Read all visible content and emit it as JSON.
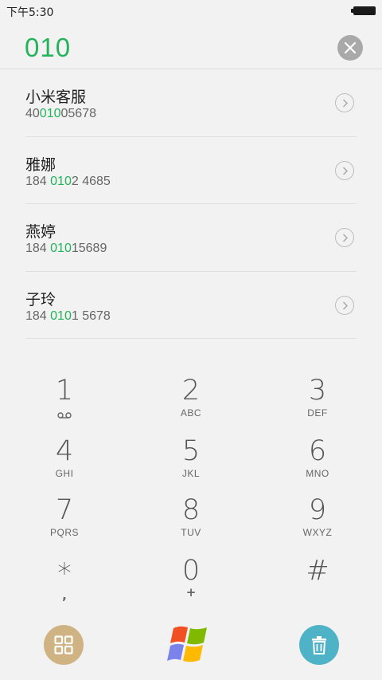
{
  "status": {
    "time": "下午5:30"
  },
  "dialer": {
    "number": "010",
    "contacts": [
      {
        "name": "小米客服",
        "num_pre": "40",
        "num_match": "010",
        "num_post": "05678"
      },
      {
        "name": "雅娜",
        "num_pre": "184 ",
        "num_match": "010",
        "num_post": "2 4685"
      },
      {
        "name": "燕婷",
        "num_pre": "184 ",
        "num_match": "010",
        "num_post": "15689"
      },
      {
        "name": "子玲",
        "num_pre": "184 ",
        "num_match": "010",
        "num_post": "1 5678"
      }
    ],
    "keys": [
      {
        "digit": "1",
        "letters": "",
        "sub": ""
      },
      {
        "digit": "2",
        "letters": "ABC",
        "sub": ""
      },
      {
        "digit": "3",
        "letters": "DEF",
        "sub": ""
      },
      {
        "digit": "4",
        "letters": "GHI",
        "sub": ""
      },
      {
        "digit": "5",
        "letters": "JKL",
        "sub": ""
      },
      {
        "digit": "6",
        "letters": "MNO",
        "sub": ""
      },
      {
        "digit": "7",
        "letters": "PQRS",
        "sub": ""
      },
      {
        "digit": "8",
        "letters": "TUV",
        "sub": ""
      },
      {
        "digit": "9",
        "letters": "WXYZ",
        "sub": ""
      },
      {
        "digit": "*",
        "letters": "",
        "sub": ","
      },
      {
        "digit": "0",
        "letters": "",
        "sub": "+"
      },
      {
        "digit": "#",
        "letters": "",
        "sub": ""
      }
    ]
  },
  "colors": {
    "accent": "#23b35a",
    "apps_button": "#cfb383",
    "trash_button": "#4fb3c7"
  },
  "icons": {
    "clear": "close-icon",
    "detail": "chevron-right-icon",
    "voicemail": "voicemail-icon",
    "apps": "grid-icon",
    "center": "windows-logo-icon",
    "delete": "trash-icon"
  }
}
